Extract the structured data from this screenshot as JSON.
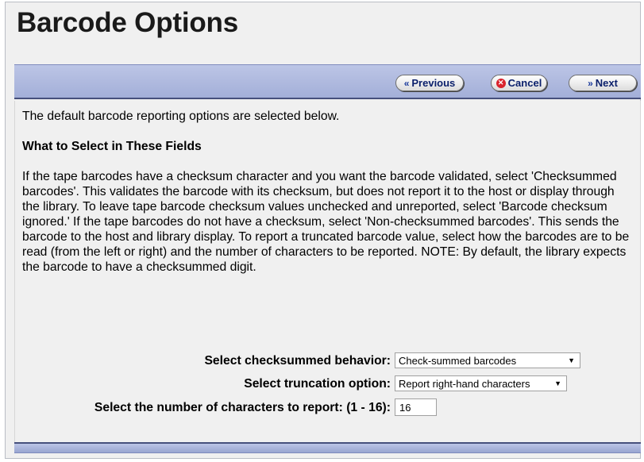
{
  "page": {
    "title": "Barcode Options"
  },
  "toolbar": {
    "previous_label": "Previous",
    "cancel_label": "Cancel",
    "next_label": "Next"
  },
  "content": {
    "intro": "The default barcode reporting options are selected below.",
    "heading": "What to Select in These Fields",
    "description": "If the tape barcodes have a checksum character and you want the barcode validated, select 'Checksummed barcodes'. This validates the barcode with its checksum, but does not report it to the host or display through the library. To leave tape barcode checksum values unchecked and unreported, select 'Barcode checksum ignored.' If the tape barcodes do not have a checksum, select 'Non-checksummed barcodes'. This sends the barcode to the host and library display. To report a truncated barcode value, select how the barcodes are to be read (from the left or right) and the number of characters to be reported. NOTE: By default, the library expects the barcode to have a checksummed digit."
  },
  "form": {
    "checksum_label": "Select checksummed behavior:",
    "checksum_value": "Check-summed barcodes",
    "truncation_label": "Select truncation option:",
    "truncation_value": "Report right-hand characters",
    "count_label": "Select the number of characters to report: (1 - 16):",
    "count_value": "16"
  },
  "icons": {
    "previous": "double-chevron-left-icon",
    "cancel": "cancel-circle-icon",
    "next": "double-chevron-right-icon",
    "dropdown": "dropdown-arrow-icon"
  },
  "colors": {
    "toolbar": "#a3afd8",
    "toolbar_border": "#46507c",
    "button_text": "#0a1f6b",
    "cancel_icon": "#d9232c"
  }
}
